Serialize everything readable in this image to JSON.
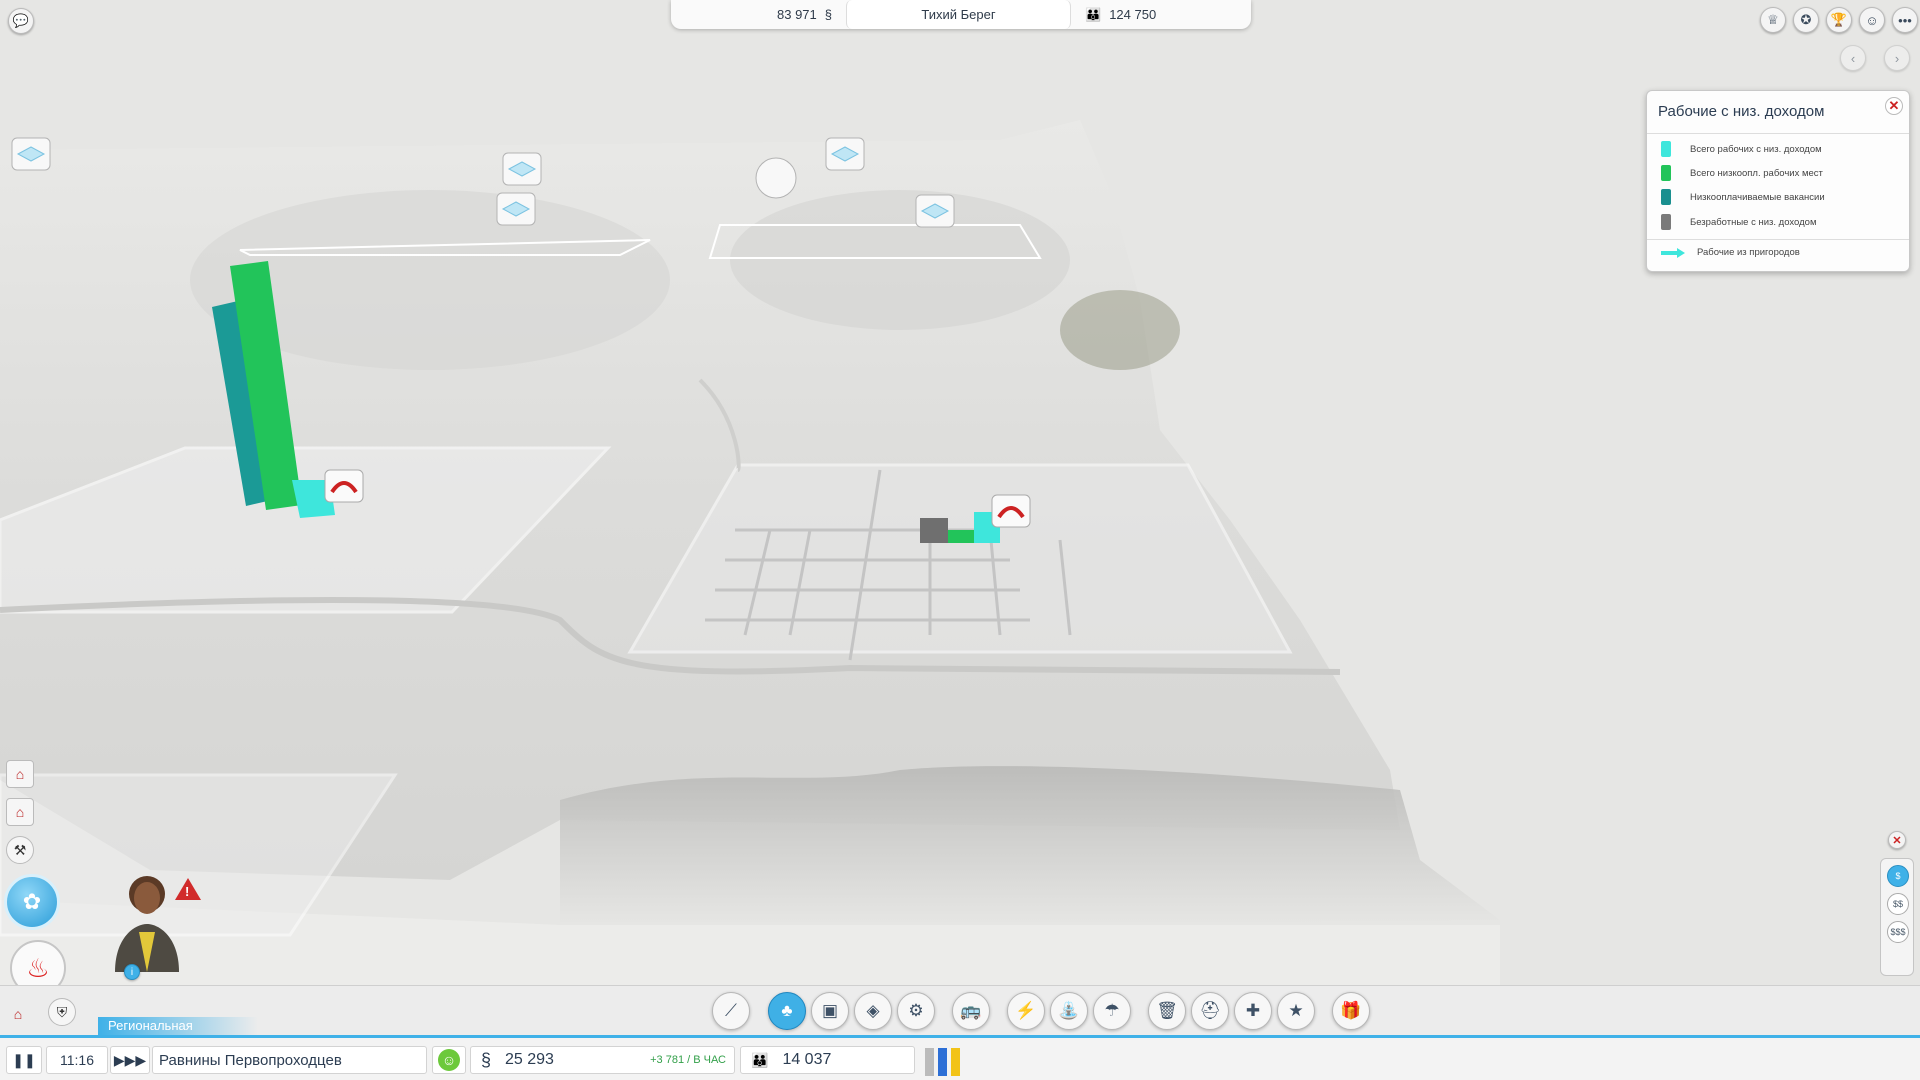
{
  "topbar": {
    "money": "83 971",
    "city_name": "Тихий Берег",
    "population": "124 750"
  },
  "top_right_icons": [
    "medal-icon",
    "achievement-icon",
    "trophy-icon",
    "friends-icon",
    "more-icon"
  ],
  "legend": {
    "title": "Рабочие с низ. доходом",
    "close_label": "✕",
    "items": [
      {
        "label": "Всего рабочих с низ. доходом",
        "color": "#3ee6dc"
      },
      {
        "label": "Всего низкоопл. рабочих мест",
        "color": "#22c45a"
      },
      {
        "label": "Низкооплачиваемые вакансии",
        "color": "#1a8f8f"
      },
      {
        "label": "Безработные с низ. доходом",
        "color": "#7a7a7a"
      },
      {
        "label": "Рабочие из пригородов",
        "color": "#3ee6dc"
      }
    ]
  },
  "region_label": "Региональная",
  "status": {
    "time": "11:16",
    "region_name": "Равнины Первопроходцев",
    "funds": "25 293",
    "rate": "+3 781 / В ЧАС",
    "city_population": "14 037"
  },
  "zoom": {
    "labels": [
      "$",
      "$$",
      "$$$"
    ]
  },
  "toolbar": {
    "tools": [
      "road-tool-icon",
      "zones-tool-icon",
      "city-hall-icon",
      "government-icon",
      "zoning-map-icon",
      "transport-icon",
      "power-icon",
      "water-icon",
      "sewage-icon",
      "garbage-icon",
      "fire-icon",
      "health-icon",
      "police-icon",
      "gift-icon"
    ]
  },
  "colors": {
    "accent": "#3fb1e8",
    "alert": "#d12b2b"
  }
}
